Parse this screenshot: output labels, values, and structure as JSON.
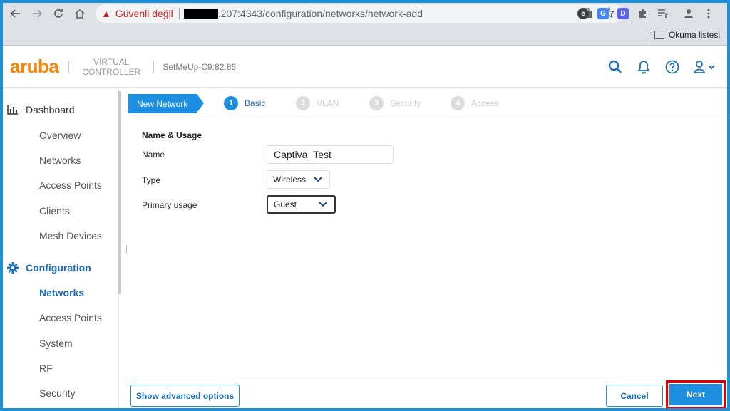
{
  "browser": {
    "security_warning": "Güvenli değil",
    "url_suffix": ".207:4343/configuration/networks/network-add",
    "reading_list": "Okuma listesi"
  },
  "header": {
    "logo": "aruba",
    "product_line1": "VIRTUAL",
    "product_line2": "CONTROLLER",
    "device": "SetMeUp-C9:82:86"
  },
  "sidebar": {
    "dashboard": {
      "label": "Dashboard",
      "items": [
        "Overview",
        "Networks",
        "Access Points",
        "Clients",
        "Mesh Devices"
      ]
    },
    "configuration": {
      "label": "Configuration",
      "items": [
        "Networks",
        "Access Points",
        "System",
        "RF",
        "Security"
      ],
      "active": "Networks"
    }
  },
  "wizard": {
    "first": "New Network",
    "steps": [
      {
        "num": "1",
        "label": "Basic",
        "active": true
      },
      {
        "num": "2",
        "label": "VLAN",
        "active": false
      },
      {
        "num": "3",
        "label": "Security",
        "active": false
      },
      {
        "num": "4",
        "label": "Access",
        "active": false
      }
    ]
  },
  "form": {
    "section_title": "Name & Usage",
    "name_label": "Name",
    "name_value": "Captiva_Test",
    "type_label": "Type",
    "type_value": "Wireless",
    "usage_label": "Primary usage",
    "usage_value": "Guest"
  },
  "footer": {
    "advanced": "Show advanced options",
    "cancel": "Cancel",
    "next": "Next"
  },
  "colors": {
    "accent": "#1d8fe0",
    "brand": "#ff8300",
    "highlight": "#e00000"
  }
}
